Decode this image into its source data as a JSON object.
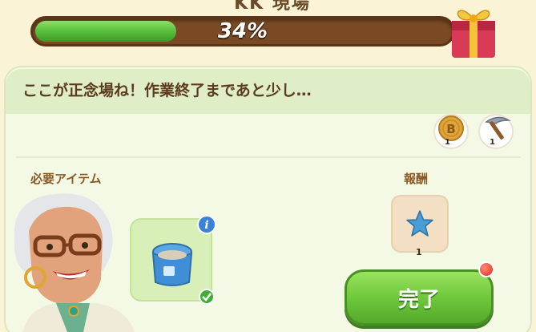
{
  "header": {
    "title_partial": "KK 現場",
    "progress": {
      "value_percent": 34,
      "label": "34%"
    },
    "gift_icon": "gift-box-icon"
  },
  "dialog": {
    "message": "ここが正念場ね！作業終了まであと少し…",
    "cost_chips": [
      {
        "icon": "b-coin-icon",
        "count": "1"
      },
      {
        "icon": "pickaxe-icon",
        "count": "1"
      }
    ],
    "required_items_label": "必要アイテム",
    "required_item": {
      "icon": "blue-container-icon",
      "info_icon": "info-icon",
      "status_icon": "check-icon"
    },
    "reward_label": "報酬",
    "reward": {
      "icon": "blue-star-icon",
      "count": "1"
    },
    "complete_button": "完了"
  },
  "colors": {
    "progress_fill": "#5cc23f",
    "progress_track": "#7a4a24",
    "button_green": "#6fc83c",
    "notification_red": "#e02a18"
  }
}
